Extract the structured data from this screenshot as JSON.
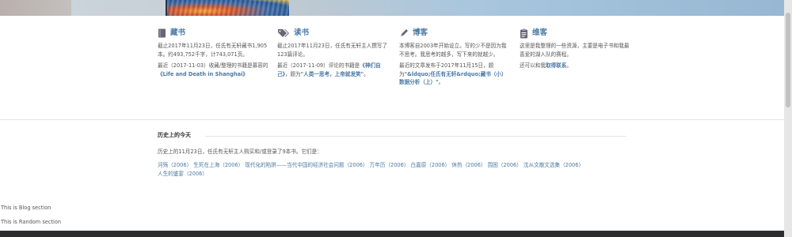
{
  "columns": [
    {
      "icon": "book-icon",
      "title": "藏书",
      "lines": [
        "截止2017年11月23日，任氏有无轩藏书1,905本。约493,752千字，计743,071页。"
      ],
      "recent_prefix": "最近（2017-11-03）收藏/整理的书籍是慕容的",
      "recent_link": "《Life and Death in Shanghai》"
    },
    {
      "icon": "tags-icon",
      "title": "读书",
      "lines": [
        "截止2017年11月23日，任氏有无轩主人撰写了123篇评论。"
      ],
      "recent_prefix": "最近（2017-11-09）评论的书籍是",
      "recent_link": "《神们自己》",
      "recent_mid": "，题为",
      "recent_link2": "\"人类一思考，上帝就发笑\"",
      "recent_suffix": "。"
    },
    {
      "icon": "pencil-icon",
      "title": "博客",
      "lines": [
        "本博客自2003年开始设立。写的少不是因为我不思考。我思考的越多，写下来的就越少。"
      ],
      "recent_prefix": "最近的文章发布于2017年11月15日，题为",
      "recent_link": "\"&ldquo;任氏有无轩&rdquo;藏书（小）数据分析（上）\"",
      "recent_suffix": "。"
    },
    {
      "icon": "clipboard-icon",
      "title": "维客",
      "lines": [
        "这里是我整理的一些资源，主要是电子书和我最喜爱的湖人队的赛程。"
      ],
      "recent_prefix": "还可以和我",
      "recent_link": "取得联系",
      "recent_suffix": "。"
    }
  ],
  "history": {
    "title": "历史上的今天",
    "desc": "历史上的11月23日，任氏有无轩主人购买和/或登录了9本书。它们是：",
    "books": [
      "河殇（2006）",
      "生死在上海（2006）",
      "现代化的陷阱——当代中国的经济社会问题（2006）",
      "万年历（2006）",
      "白嘉原（2006）",
      "休热（2006）",
      "围困（2006）",
      "沈从文散文选集（2006）",
      "人生的盛宴（2006）"
    ]
  },
  "sections": {
    "blog": "This is Blog section",
    "random": "This is Random section"
  },
  "colors": {
    "accent": "#4a79a5",
    "footer": "#2b2d2f"
  }
}
